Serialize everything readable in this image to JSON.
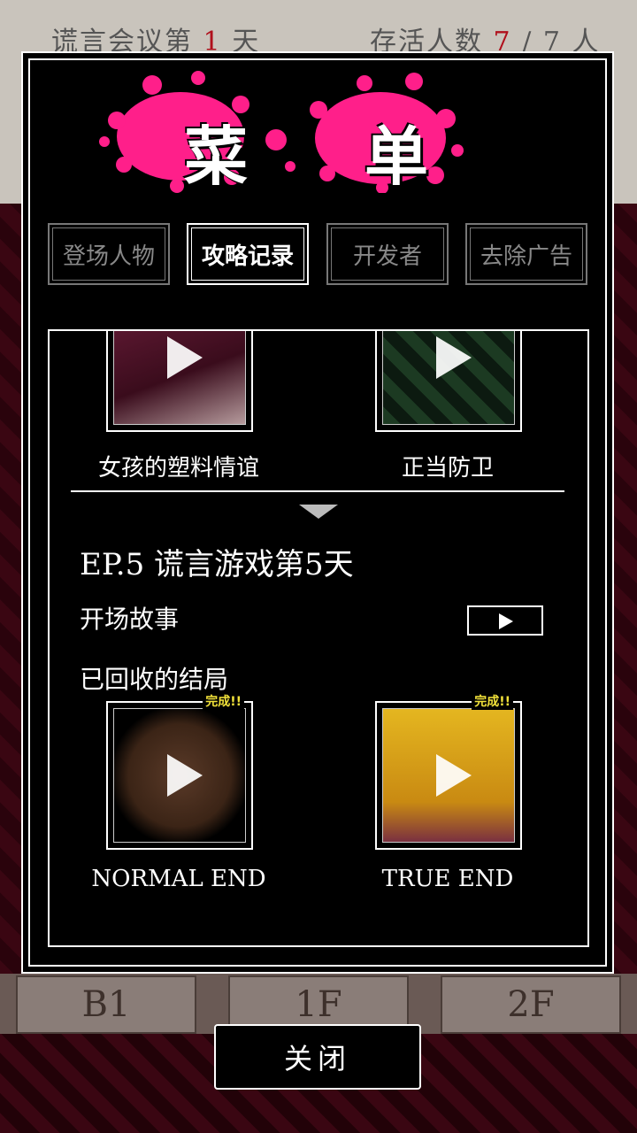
{
  "background": {
    "status_left_prefix": "谎言会议第",
    "status_left_day": "1",
    "status_left_suffix": "天",
    "status_right_prefix": "存活人数",
    "status_right_alive": "7",
    "status_right_suffix": "/ 7 人",
    "floors": [
      "B1",
      "1F",
      "2F"
    ]
  },
  "menu": {
    "title_chars": [
      "菜",
      "单"
    ],
    "tabs": [
      {
        "label": "登场人物",
        "active": false
      },
      {
        "label": "攻略记录",
        "active": true
      },
      {
        "label": "开发者",
        "active": false
      },
      {
        "label": "去除广告",
        "active": false
      }
    ],
    "prev_episode_endings": [
      {
        "label": "女孩的塑料情谊"
      },
      {
        "label": "正当防卫"
      }
    ],
    "episode": {
      "title": "EP.5  谎言游戏第5天",
      "opening_label": "开场故事",
      "endings_label": "已回收的结局",
      "endings": [
        {
          "label": "NORMAL END",
          "badge": "完成!!"
        },
        {
          "label": "TRUE END",
          "badge": "完成!!"
        }
      ]
    },
    "close_label": "关闭"
  },
  "colors": {
    "splat_pink": "#ff1f8a",
    "badge_yellow": "#f2e23a",
    "status_red": "#b0101c"
  }
}
